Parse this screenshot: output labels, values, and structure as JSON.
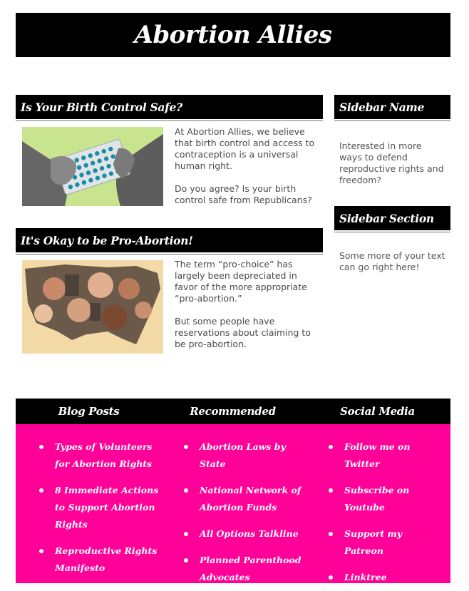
{
  "site": {
    "title": "Abortion Allies"
  },
  "posts": [
    {
      "title": "Is Your Birth Control Safe?",
      "paragraphs": [
        "At Abortion Allies, we believe that birth control and access to contraception is a universal human right.",
        "Do you agree? Is your birth control safe from Republicans?"
      ],
      "image_icon": "birth-control-pills-image"
    },
    {
      "title": "It's Okay to be Pro-Abortion!",
      "paragraphs": [
        "The term “pro-choice” has largely been depreciated in favor of the more appropriate “pro-abortion.”",
        "But some people have reservations about claiming to be pro-abortion."
      ],
      "image_icon": "us-map-collage-image"
    }
  ],
  "sidebar": [
    {
      "title": "Sidebar Name",
      "text": "Interested in more ways to defend reproductive rights and freedom?"
    },
    {
      "title": "Sidebar Section",
      "text": "Some more of your text can go right here!"
    }
  ],
  "footer": {
    "columns": [
      {
        "heading": "Blog Posts",
        "links": [
          "Types of Volunteers for Abortion Rights",
          "8 Immediate Actions to Support Abortion Rights",
          "Reproductive Rights Manifesto"
        ]
      },
      {
        "heading": "Recommended",
        "links": [
          "Abortion Laws by State",
          "National Network of Abortion Funds",
          "All Options Talkline",
          "Planned Parenthood Advocates"
        ]
      },
      {
        "heading": "Social Media",
        "links": [
          "Follow me on Twitter",
          "Subscribe on Youtube",
          "Support my Patreon",
          "Linktree"
        ]
      }
    ]
  },
  "colors": {
    "accent": "#ff0099",
    "header": "#000000",
    "text": "#4a4a4a"
  }
}
